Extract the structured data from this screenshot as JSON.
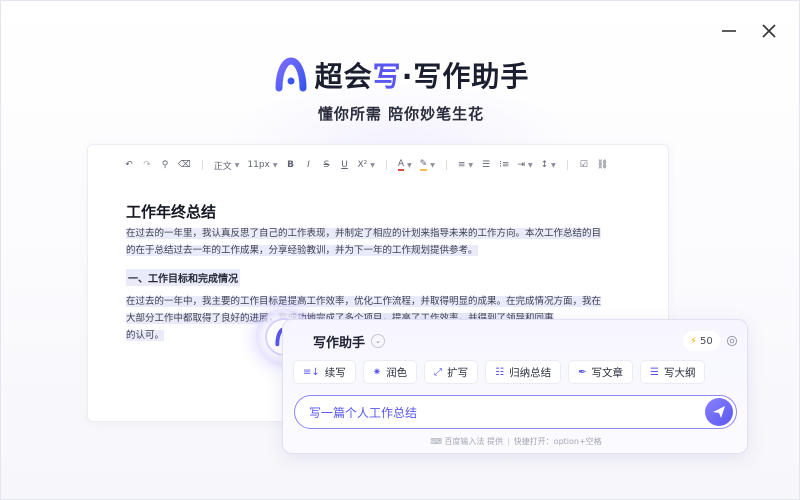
{
  "window": {
    "minimize_icon": "minimize-icon",
    "close_icon": "close-icon"
  },
  "brand": {
    "logo_icon": "a-logo-icon",
    "title_prefix": "超会",
    "title_accent": "写",
    "title_suffix": "·写作助手",
    "accent_color": "#5a57f0",
    "slogan": "懂你所需  陪你妙笔生花"
  },
  "toolbar": {
    "undo_icon": "undo-icon",
    "redo_icon": "redo-icon",
    "format_painter_icon": "format-painter-icon",
    "clear_format_icon": "eraser-icon",
    "paragraph_style": "正文",
    "font_size": "11px",
    "bold": "B",
    "italic": "I",
    "strike": "S",
    "underline": "U",
    "superscript": "X²",
    "font_color": "A",
    "highlight_icon": "highlight-icon",
    "align_icon": "align-icon",
    "list_icon": "bullet-list-icon",
    "ordered_list_icon": "ordered-list-icon",
    "indent_icon": "indent-icon",
    "line_height_icon": "line-height-icon",
    "checkbox_icon": "checkbox-icon",
    "link_icon": "link-icon"
  },
  "document": {
    "title": "工作年终总结",
    "paragraph1_line1": "在过去的一年里，我认真反思了自己的工作表现，并制定了相应的计划来指导未来的工作方向。本次工作总结的目",
    "paragraph1_line2": "的在于总结过去一年的工作成果，分享经验教训，并为下一年的工作规划提供参考。",
    "subheading": "一、工作目标和完成情况",
    "paragraph2_line1": "在过去的一年中，我主要的工作目标是提高工作效率，优化工作流程，并取得明显的成果。在完成情况方面，我在",
    "paragraph2_line2": "大部分工作中都取得了良好的进展，我成功地完成了多个项目，提高了工作效率，并得到了领导和同事",
    "paragraph2_line3": "的认可。"
  },
  "assistant": {
    "title": "写作助手",
    "dropdown_icon": "chevron-down-icon",
    "credits": "50",
    "credits_icon": "lightning-icon",
    "settings_icon": "gear-icon",
    "chips": [
      {
        "label": "续写",
        "icon": "continue-icon"
      },
      {
        "label": "润色",
        "icon": "polish-icon"
      },
      {
        "label": "扩写",
        "icon": "expand-icon"
      },
      {
        "label": "归纳总结",
        "icon": "summary-icon"
      },
      {
        "label": "写文章",
        "icon": "pen-icon"
      },
      {
        "label": "写大纲",
        "icon": "outline-icon"
      }
    ],
    "prompt_value": "写一篇个人工作总结",
    "send_icon": "send-icon",
    "footer_provider": "百度输入法 提供",
    "footer_shortcut": "快捷打开：option+空格"
  }
}
